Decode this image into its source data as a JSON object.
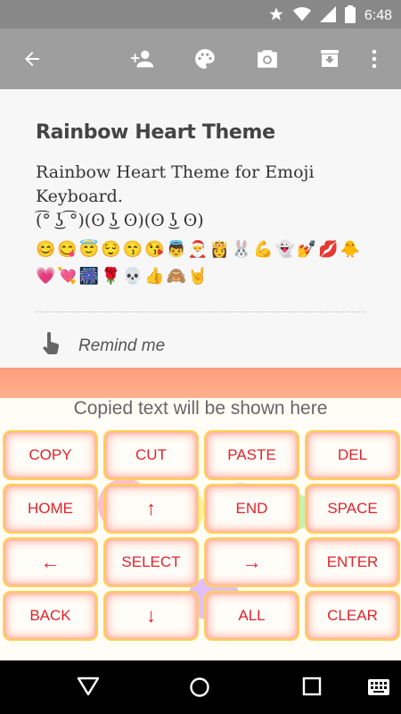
{
  "status_bar": {
    "time": "6:48"
  },
  "note": {
    "title": "Rainbow Heart Theme",
    "body": "Rainbow Heart Theme for Emoji Keyboard.\n(͡° ͜ʖ ͡°)(ʘ ͜ʖ ʘ)(ʘ ͜ʖ ʘ)",
    "emoji_line_1": "😊😋😇😌😙😘👼🎅👸🐰💪👻💅💋🐥",
    "emoji_line_2": "💗💘🎆🌹💀👍🙈🤘",
    "reminder_label": "Remind me"
  },
  "keyboard": {
    "copied_text": "Copied text will be shown here",
    "keys": [
      "COPY",
      "CUT",
      "PASTE",
      "DEL",
      "HOME",
      "↑",
      "END",
      "SPACE",
      "←",
      "SELECT",
      "→",
      "ENTER",
      "BACK",
      "↓",
      "ALL",
      "CLEAR"
    ]
  },
  "colors": {
    "key_text": "#e0232b",
    "key_border": "#ffd24d",
    "strip": "#ff9c7a",
    "toolbar": "#9e9e9e"
  }
}
